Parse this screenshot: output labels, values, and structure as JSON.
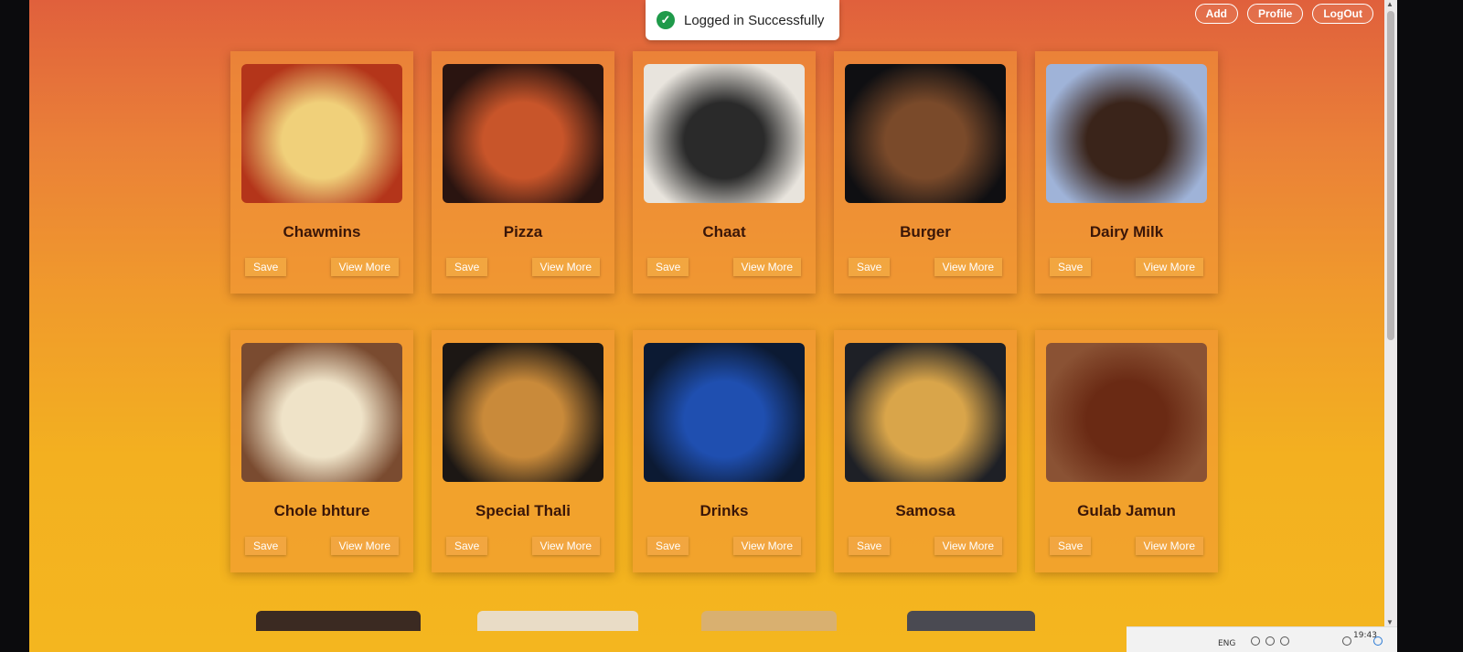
{
  "nav": {
    "add_label": "Add",
    "profile_label": "Profile",
    "logout_label": "LogOut"
  },
  "toast": {
    "message": "Logged in Successfully",
    "status_color": "#1f9a4a"
  },
  "card_actions": {
    "save_label": "Save",
    "view_more_label": "View More"
  },
  "menu": [
    {
      "name": "Chawmins",
      "image": "noodles-photo",
      "colors": [
        "#b4351a",
        "#f0d07a"
      ]
    },
    {
      "name": "Pizza",
      "image": "pizza-photo",
      "colors": [
        "#2a1410",
        "#c8552a"
      ]
    },
    {
      "name": "Chaat",
      "image": "chaat-photo",
      "colors": [
        "#e8e4dd",
        "#2a2a2a"
      ]
    },
    {
      "name": "Burger",
      "image": "burger-photo",
      "colors": [
        "#0f0f12",
        "#7a4a2a"
      ]
    },
    {
      "name": "Dairy Milk",
      "image": "chocolate-photo",
      "colors": [
        "#9fb3d8",
        "#3a241a"
      ]
    },
    {
      "name": "Chole bhture",
      "image": "chole-photo",
      "colors": [
        "#7a4b30",
        "#efe3c8"
      ]
    },
    {
      "name": "Special Thali",
      "image": "thali-photo",
      "colors": [
        "#1c1714",
        "#c98a3a"
      ]
    },
    {
      "name": "Drinks",
      "image": "pepsi-photo",
      "colors": [
        "#0c1a33",
        "#1f4fb0"
      ]
    },
    {
      "name": "Samosa",
      "image": "samosa-photo",
      "colors": [
        "#1e2026",
        "#d9a54a"
      ]
    },
    {
      "name": "Gulab Jamun",
      "image": "gulab-jamun-photo",
      "colors": [
        "#8a5234",
        "#6a2a14"
      ]
    }
  ],
  "taskbar": {
    "language": "ENG",
    "time": "19:43"
  }
}
